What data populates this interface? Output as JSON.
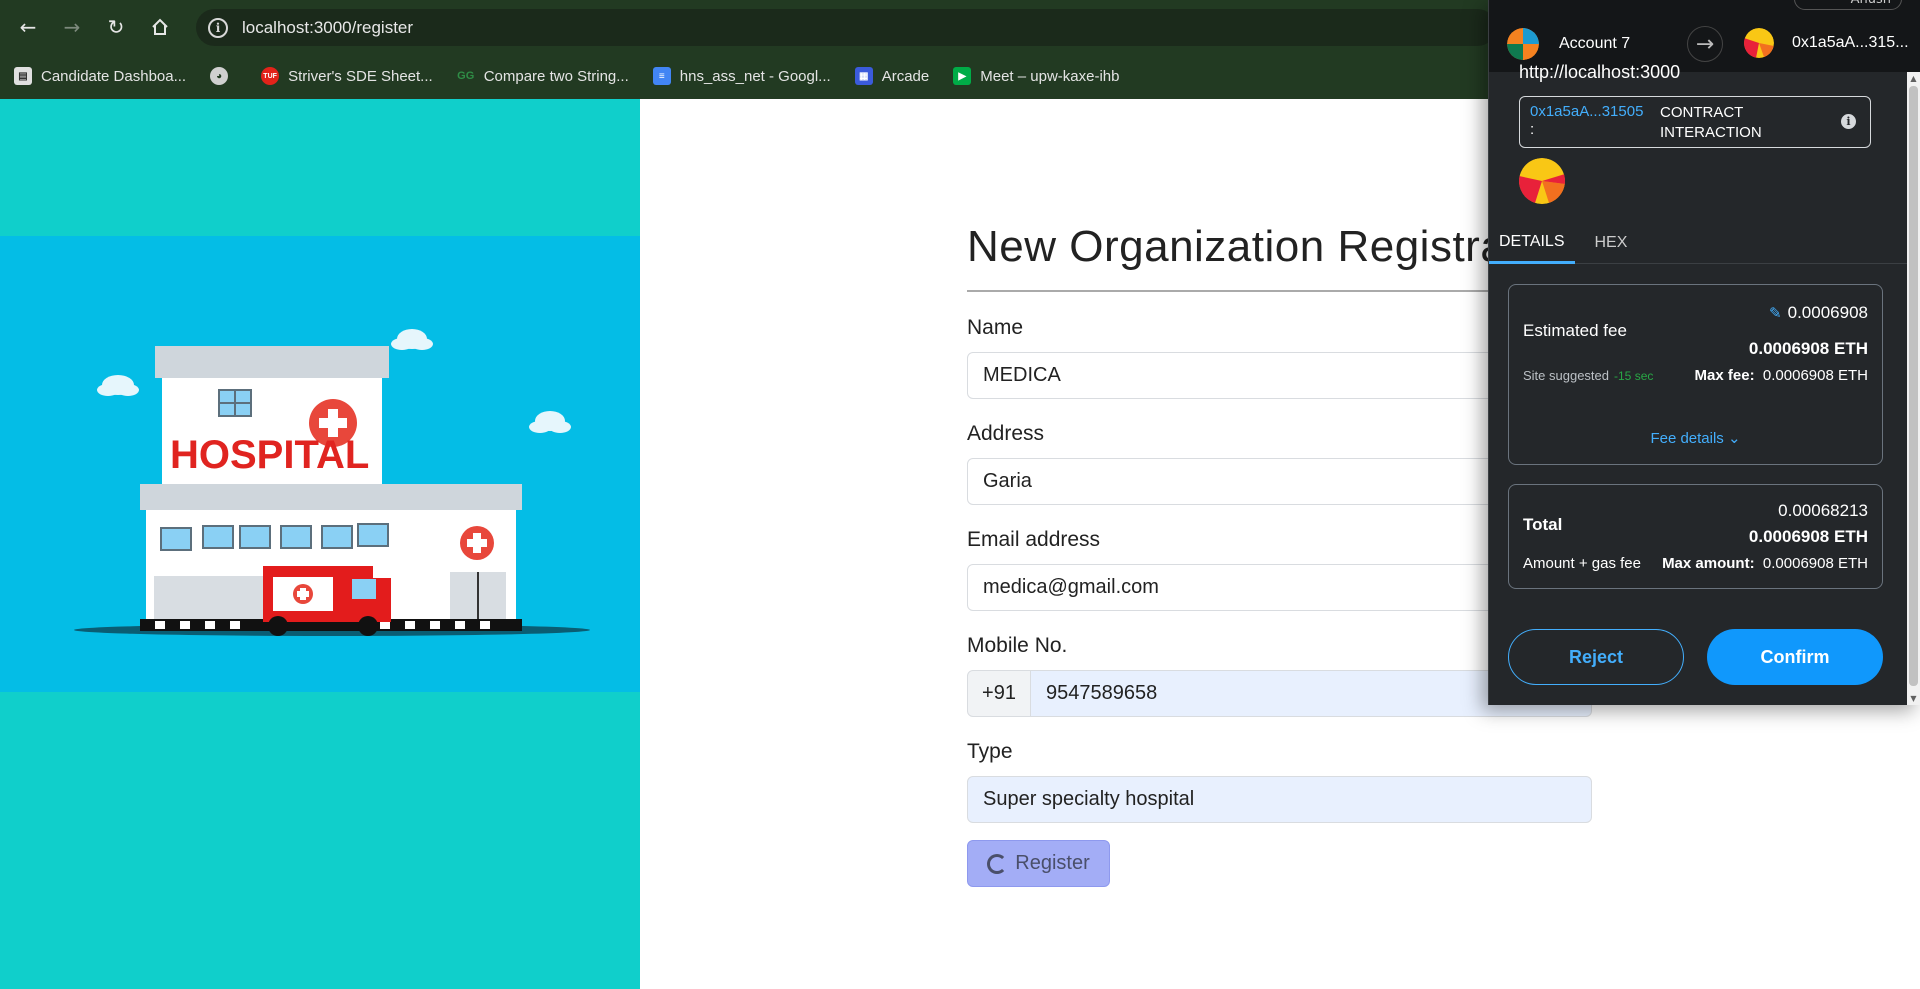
{
  "browser": {
    "url": "localhost:3000/register",
    "bookmarks": [
      {
        "label": "Candidate Dashboa...",
        "icon": "candidate-icon",
        "color": "#cccccc"
      },
      {
        "label": "",
        "icon": "globe-icon",
        "color": "#cccccc"
      },
      {
        "label": "Striver's SDE Sheet...",
        "icon": "tuf-icon",
        "color": "#e2231a"
      },
      {
        "label": "Compare two String...",
        "icon": "gfg-icon",
        "color": "#2f8d46"
      },
      {
        "label": "hns_ass_net - Googl...",
        "icon": "docs-icon",
        "color": "#4285f4"
      },
      {
        "label": "Arcade",
        "icon": "arcade-icon",
        "color": "#3b5bdb"
      },
      {
        "label": "Meet – upw-kaxe-ihb",
        "icon": "meet-icon",
        "color": "#00ac47"
      }
    ]
  },
  "form": {
    "title": "New Organization Registra",
    "name_label": "Name",
    "name_value": "MEDICA",
    "address_label": "Address",
    "address_value": "Garia",
    "email_label": "Email address",
    "email_value": "medica@gmail.com",
    "mobile_label": "Mobile No.",
    "mobile_prefix": "+91",
    "mobile_value": "9547589658",
    "type_label": "Type",
    "type_value": "Super specialty hospital",
    "register_label": "Register"
  },
  "illustration": {
    "hospital_text": "HOSPITAL"
  },
  "metamask": {
    "user_pill": "Anush",
    "from_account": "Account 7",
    "to_account": "0x1a5aA...315...",
    "origin": "http://localhost:3000",
    "contract_address": "0x1a5aA...31505",
    "contract_colon": ":",
    "contract_type": "CONTRACT INTERACTION",
    "tabs": [
      "DETAILS",
      "HEX"
    ],
    "estimated_fee_label": "Estimated fee",
    "estimated_fee_value": "0.0006908",
    "estimated_fee_eth": "0.0006908 ETH",
    "site_suggested": "Site suggested",
    "timer": "-15 sec",
    "max_fee_label": "Max fee:",
    "max_fee_value": "0.0006908 ETH",
    "fee_details": "Fee details",
    "total_label": "Total",
    "total_value": "0.00068213",
    "total_eth": "0.0006908 ETH",
    "amount_gas_label": "Amount + gas fee",
    "max_amount_label": "Max amount:",
    "max_amount_value": "0.0006908 ETH",
    "reject_label": "Reject",
    "confirm_label": "Confirm"
  },
  "colors": {
    "left_bg": "#10cfcb",
    "hospital_bg": "#04bde6",
    "register_button": "#a3adf6",
    "metamask_blue": "#1098fc"
  }
}
